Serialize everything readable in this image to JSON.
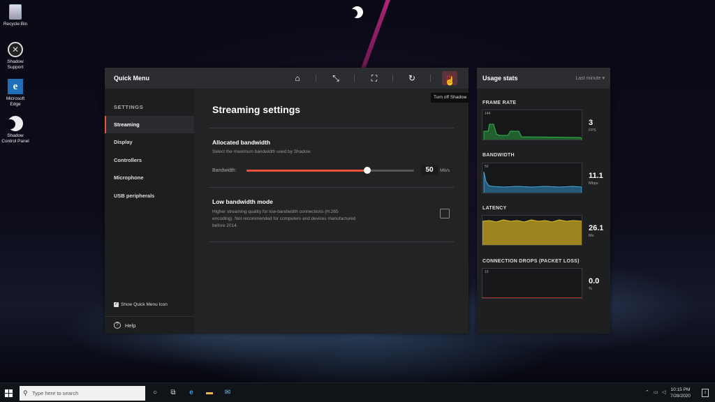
{
  "desktop_icons": [
    {
      "label": "Recycle Bin",
      "icon": "recycle-bin-icon"
    },
    {
      "label": "Shadow Support",
      "icon": "wrench-icon"
    },
    {
      "label": "Microsoft Edge",
      "icon": "edge-icon"
    },
    {
      "label": "Shadow Control Panel",
      "icon": "shadow-logo-icon"
    }
  ],
  "quick_menu": {
    "title": "Quick Menu",
    "toolbar": {
      "home": "home-icon",
      "exit_fullscreen": "shrink-icon",
      "fullscreen": "expand-icon",
      "reload": "reload-icon",
      "power": "power-icon"
    },
    "tooltip": "Turn off Shadow",
    "sidebar": {
      "heading": "SETTINGS",
      "items": [
        "Streaming",
        "Display",
        "Controllers",
        "Microphone",
        "USB peripherals"
      ],
      "active": "Streaming",
      "show_icon_label": "Show Quick Menu Icon",
      "show_icon_checked": true,
      "help_label": "Help"
    },
    "main": {
      "title": "Streaming settings",
      "bandwidth": {
        "title": "Allocated bandwidth",
        "description": "Select the maximum bandwidth used by Shadow.",
        "label": "Bandwidth:",
        "value": "50",
        "unit": "Mb/s",
        "fraction": 0.72
      },
      "low_bandwidth": {
        "title": "Low bandwidth mode",
        "description_lines": [
          "Higher streaming quality for low-bandwidth connections (H.265",
          "encoding). Not recommended for computers and devices manufactured",
          "before 2014."
        ],
        "checked": false
      }
    }
  },
  "usage_stats": {
    "title": "Usage stats",
    "range": "Last minute",
    "stats": [
      {
        "label": "FRAME RATE",
        "max": "144",
        "value": "3",
        "unit": "FPS",
        "color": "#2fb84a"
      },
      {
        "label": "BANDWIDTH",
        "max": "50",
        "value": "11.1",
        "unit": "Mbps",
        "color": "#2f8fc4"
      },
      {
        "label": "LATENCY",
        "max": "",
        "value": "26.1",
        "unit": "Ms",
        "color": "#c8a820"
      },
      {
        "label": "CONNECTION DROPS (PACKET LOSS)",
        "max": "10",
        "value": "0.0",
        "unit": "%",
        "color": "#d23b3b"
      }
    ]
  },
  "taskbar": {
    "search_placeholder": "Type here to search",
    "time": "10:15 PM",
    "date": "7/28/2020",
    "notification_count": "2"
  }
}
